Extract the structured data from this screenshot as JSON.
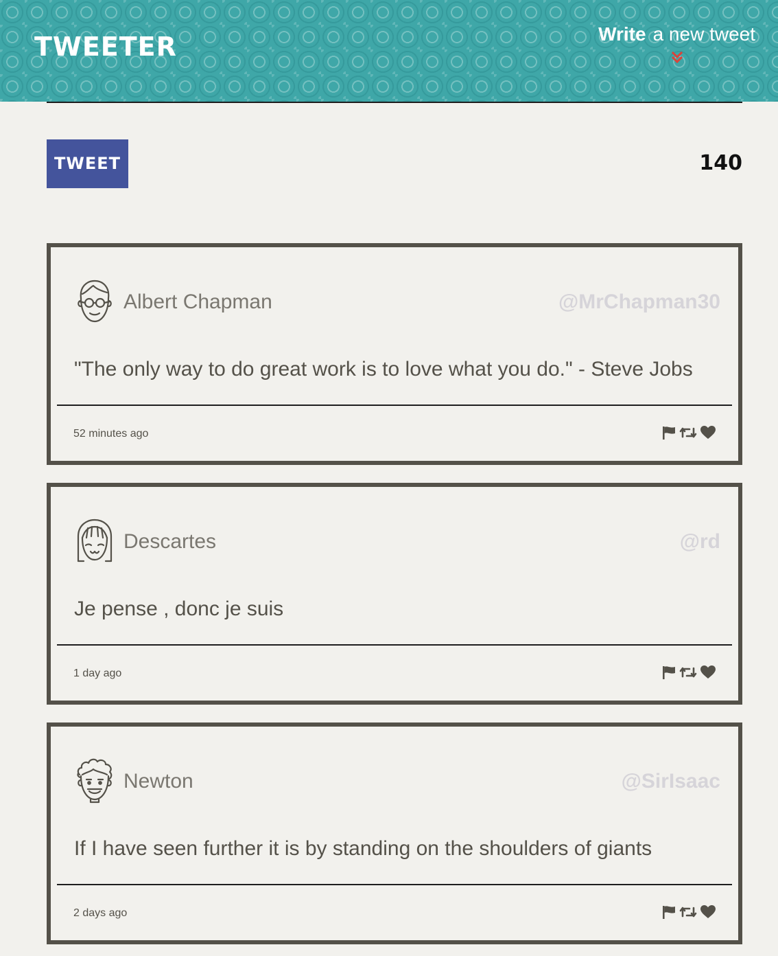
{
  "header": {
    "brand": "TWEETER",
    "compose_strong": "Write",
    "compose_rest": "a new tweet",
    "bg_color": "#3fa7a8",
    "chevron_color": "#d9443a"
  },
  "composer": {
    "button_label": "TWEET",
    "button_color": "#44549c",
    "char_count": "140"
  },
  "tweets": [
    {
      "avatar": "glasses-man-avatar",
      "name": "Albert Chapman",
      "handle": "@MrChapman30",
      "text": "\"The only way to do great work is to love what you do.\" - Steve Jobs",
      "time": "52 minutes ago",
      "actions": [
        "flag-icon",
        "retweet-icon",
        "heart-icon"
      ]
    },
    {
      "avatar": "bangs-girl-avatar",
      "name": "Descartes",
      "handle": "@rd",
      "text": "Je pense , donc je suis",
      "time": "1 day ago",
      "actions": [
        "flag-icon",
        "retweet-icon",
        "heart-icon"
      ]
    },
    {
      "avatar": "curly-hair-man-avatar",
      "name": "Newton",
      "handle": "@SirIsaac",
      "text": "If I have seen further it is by standing on the shoulders of giants",
      "time": "2 days ago",
      "actions": [
        "flag-icon",
        "retweet-icon",
        "heart-icon"
      ]
    }
  ]
}
